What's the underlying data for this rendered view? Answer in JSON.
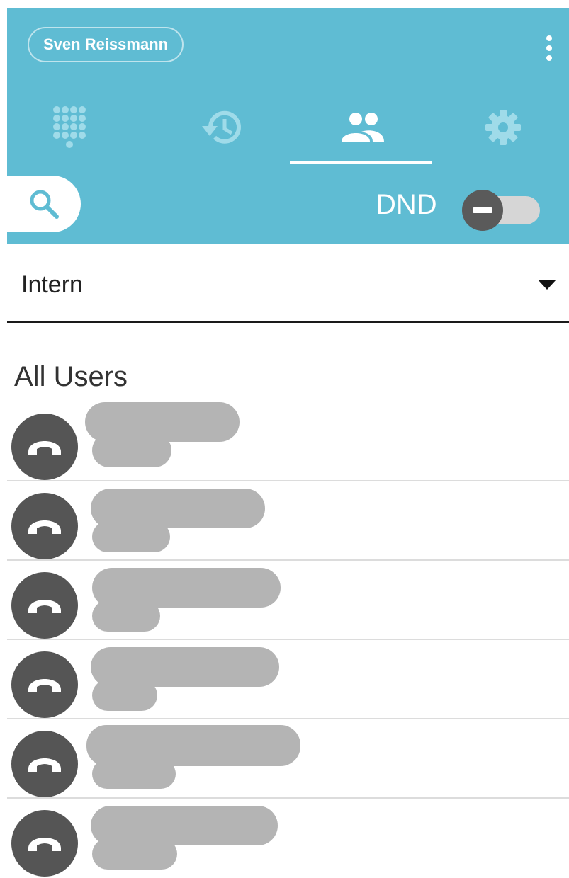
{
  "header": {
    "user_name": "Sven Reissmann",
    "tabs": [
      {
        "icon": "dialpad-icon",
        "active": false
      },
      {
        "icon": "history-icon",
        "active": false
      },
      {
        "icon": "contacts-icon",
        "active": true
      },
      {
        "icon": "settings-icon",
        "active": false
      }
    ],
    "dnd_label": "DND",
    "dnd_enabled": false
  },
  "filter": {
    "selected": "Intern"
  },
  "contacts": {
    "section_title": "All Users",
    "rows": [
      {
        "name": "",
        "number": ""
      },
      {
        "name": "",
        "number": ""
      },
      {
        "name": "",
        "number": ""
      },
      {
        "name": "",
        "number": ""
      },
      {
        "name": "",
        "number": ""
      },
      {
        "name": "",
        "number": ""
      }
    ]
  },
  "colors": {
    "header_bg": "#5fbcd3",
    "avatar_bg": "#555555",
    "redaction": "#b4b4b4"
  }
}
